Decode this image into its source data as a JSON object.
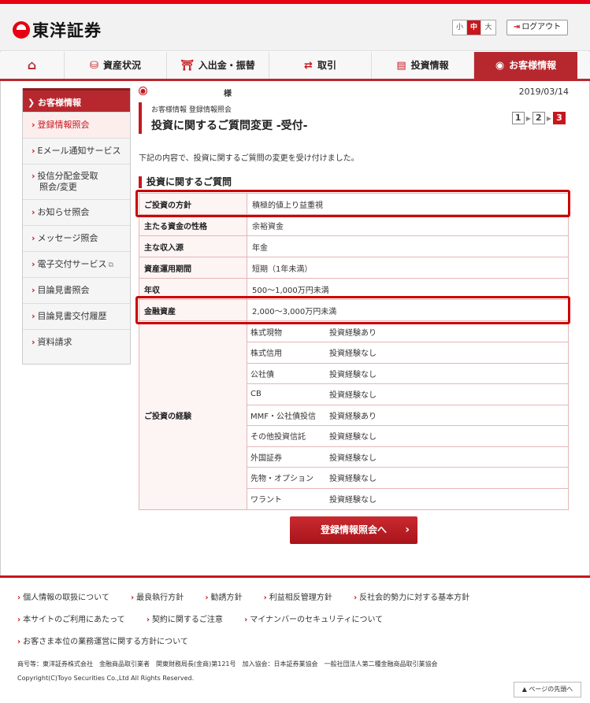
{
  "header": {
    "logo_text": "東洋証券",
    "font_sizes": [
      "小",
      "中",
      "大"
    ],
    "logout": "ログアウト"
  },
  "nav": {
    "items": [
      "資産状況",
      "入出金・振替",
      "取引",
      "投資情報",
      "お客様情報"
    ]
  },
  "sidebar": {
    "title": "お客様情報",
    "items": [
      "登録情報照会",
      "Eメール通知サービス",
      "投信分配金受取",
      "照会/変更",
      "お知らせ照会",
      "メッセージ照会",
      "電子交付サービス",
      "目論見書照会",
      "目論見書交付履歴",
      "資料請求"
    ]
  },
  "main": {
    "user_suffix": "様",
    "date": "2019/03/14",
    "breadcrumb": "お客様情報 登録情報照会",
    "title": "投資に関するご質問変更 -受付-",
    "steps": [
      "1",
      "2",
      "3"
    ],
    "lead": "下記の内容で、投資に関するご質問の変更を受け付けました。",
    "section_title": "投資に関するご質問",
    "rows": [
      {
        "k": "ご投資の方針",
        "v": "積極的値上り益重視"
      },
      {
        "k": "主たる資金の性格",
        "v": "余裕資金"
      },
      {
        "k": "主な収入源",
        "v": "年金"
      },
      {
        "k": "資産運用期間",
        "v": "短期（1年未満）"
      },
      {
        "k": "年収",
        "v": "500～1,000万円未満"
      },
      {
        "k": "金融資産",
        "v": "2,000～3,000万円未満"
      }
    ],
    "experience_label": "ご投資の経験",
    "experience": [
      {
        "item": "株式現物",
        "val": "投資経験あり"
      },
      {
        "item": "株式信用",
        "val": "投資経験なし"
      },
      {
        "item": "公社債",
        "val": "投資経験なし"
      },
      {
        "item": "CB",
        "val": "投資経験なし"
      },
      {
        "item": "MMF・公社債投信",
        "val": "投資経験あり"
      },
      {
        "item": "その他投資信託",
        "val": "投資経験なし"
      },
      {
        "item": "外国証券",
        "val": "投資経験なし"
      },
      {
        "item": "先物・オプション",
        "val": "投資経験なし"
      },
      {
        "item": "ワラント",
        "val": "投資経験なし"
      }
    ],
    "button": "登録情報照会へ"
  },
  "footer": {
    "links": [
      "個人情報の取扱について",
      "最良執行方針",
      "勧誘方針",
      "利益相反管理方針",
      "反社会的勢力に対する基本方針",
      "本サイトのご利用にあたって",
      "契約に関するご注意",
      "マイナンバーのセキュリティについて",
      "お客さま本位の業務運営に関する方針について"
    ],
    "note": "商号等：東洋証券株式会社　金融商品取引業者　関東財務局長(金商)第121号　加入協会：日本証券業協会　一般社団法人第二種金融商品取引業協会",
    "copyright": "Copyright(C)Toyo Securities Co.,Ltd All Rights Reserved.",
    "pagetop": "ページの先頭へ"
  },
  "colors": {
    "accent": "#c8161d",
    "nav_active": "#b7282e"
  }
}
